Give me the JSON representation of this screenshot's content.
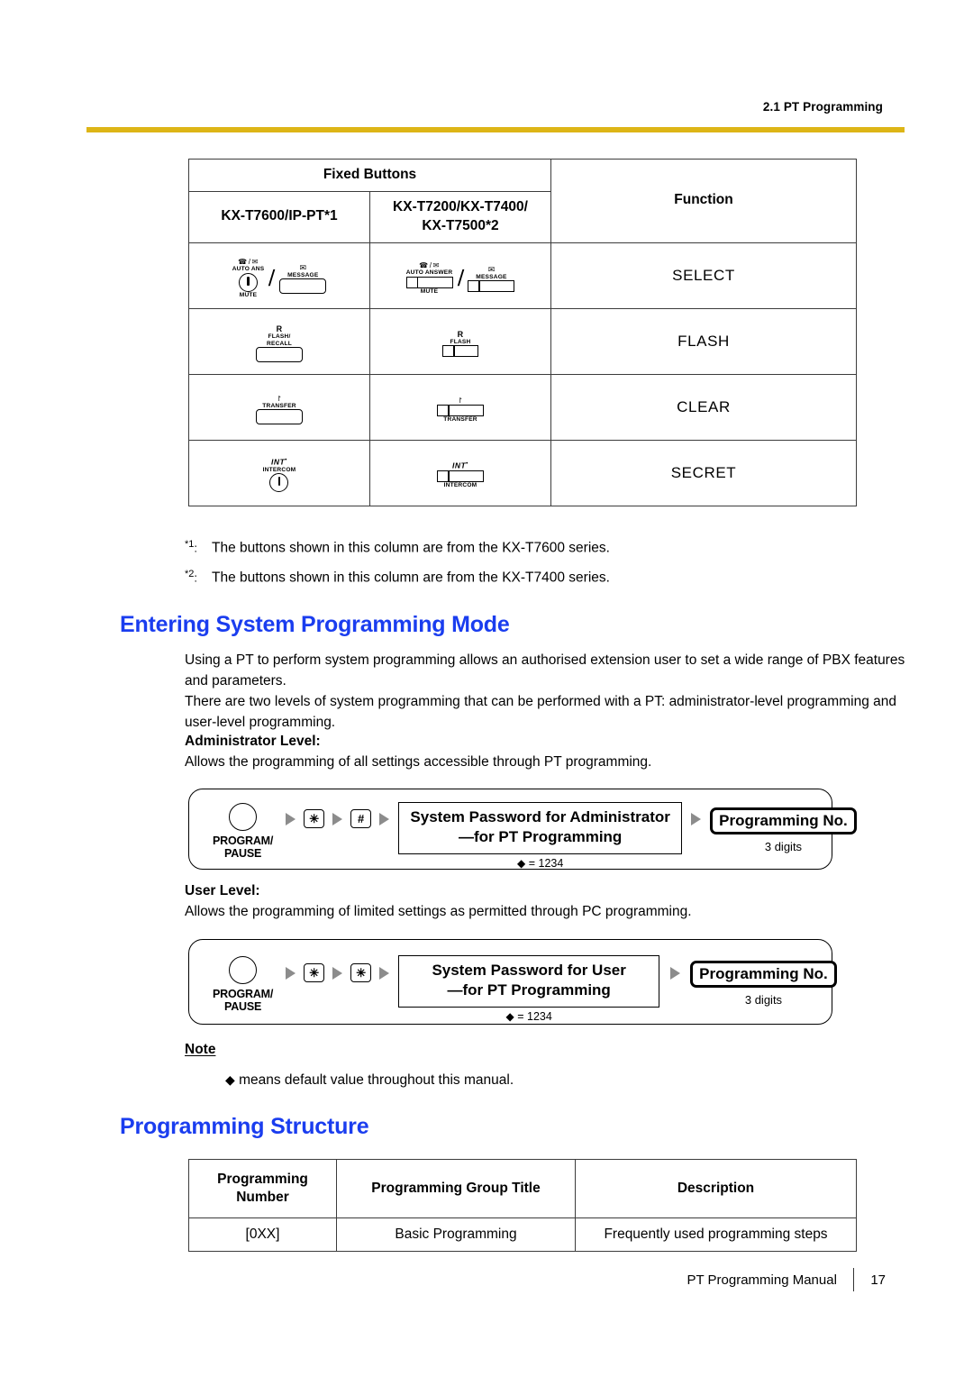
{
  "running_head": "2.1 PT Programming",
  "rule_color": "#ddb516",
  "heading_color": "#1a3def",
  "button_table": {
    "header": {
      "fixed_buttons": "Fixed Buttons",
      "col_7600": "KX-T7600/IP-PT*1",
      "col_7200_a": "KX-T7200/KX-T7400/",
      "col_7200_b": "KX-T7500*2",
      "function": "Function"
    },
    "rows": [
      {
        "function": "SELECT",
        "t7600": {
          "keys": [
            {
              "style": "round",
              "symbol": "auto-ans-mute-symbol",
              "cap_top": "AUTO ANS",
              "cap_bottom": "MUTE"
            },
            {
              "style": "rounded-rect",
              "symbol": "envelope-icon",
              "cap_top": "MESSAGE",
              "cap_bottom": ""
            }
          ]
        },
        "t7200": {
          "keys": [
            {
              "style": "flat",
              "symbol": "auto-ans-mute-symbol",
              "cap_top": "AUTO ANSWER",
              "cap_bottom": "MUTE"
            },
            {
              "style": "flat",
              "symbol": "envelope-icon",
              "cap_top": "MESSAGE",
              "cap_bottom": ""
            }
          ]
        }
      },
      {
        "function": "FLASH",
        "t7600": {
          "keys": [
            {
              "style": "rounded-rect",
              "symbol": "R",
              "cap_top": "FLASH/\nRECALL",
              "cap_bottom": ""
            }
          ]
        },
        "t7200": {
          "keys": [
            {
              "style": "flat-narrow",
              "symbol": "R",
              "cap_top": "FLASH",
              "cap_bottom": ""
            }
          ]
        }
      },
      {
        "function": "CLEAR",
        "t7600": {
          "keys": [
            {
              "style": "rounded-rect",
              "symbol": "transfer-arrow-icon",
              "cap_top": "TRANSFER",
              "cap_bottom": ""
            }
          ]
        },
        "t7200": {
          "keys": [
            {
              "style": "flat",
              "symbol": "transfer-arrow-icon",
              "cap_top": "",
              "cap_bottom": "TRANSFER"
            }
          ]
        }
      },
      {
        "function": "SECRET",
        "t7600": {
          "keys": [
            {
              "style": "round",
              "symbol": "INT",
              "cap_top": "INTERCOM",
              "cap_bottom": ""
            }
          ]
        },
        "t7200": {
          "keys": [
            {
              "style": "flat",
              "symbol": "INT",
              "cap_top": "",
              "cap_bottom": "INTERCOM"
            }
          ]
        }
      }
    ]
  },
  "footnotes": [
    {
      "mark": "*1",
      "text": "The buttons shown in this column are from the KX-T7600 series."
    },
    {
      "mark": "*2",
      "text": "The buttons shown in this column are from the KX-T7400 series."
    }
  ],
  "section_entering": {
    "title": "Entering System Programming Mode",
    "para1": "Using a PT to perform system programming allows an authorised extension user to set a wide range of PBX features and parameters.",
    "para2": "There are two levels of system programming that can be performed with a PT: administrator-level programming and user-level programming.",
    "admin_label": "Administrator Level:",
    "admin_desc": "Allows the programming of all settings accessible through PT programming.",
    "user_label": "User Level:",
    "user_desc": "Allows the programming of limited settings as permitted through PC programming."
  },
  "flow_admin": {
    "program_key_line1": "PROGRAM/",
    "program_key_line2": "PAUSE",
    "key1": "✳",
    "key2": "#",
    "password_line1": "System Password for Administrator",
    "password_line2": "—for PT Programming",
    "default_value": "= 1234",
    "diamond": "◆",
    "prog_no": "Programming No.",
    "prog_no_sub": "3 digits"
  },
  "flow_user": {
    "program_key_line1": "PROGRAM/",
    "program_key_line2": "PAUSE",
    "key1": "✳",
    "key2": "✳",
    "password_line1": "System Password for User",
    "password_line2": "—for PT Programming",
    "default_value": "= 1234",
    "diamond": "◆",
    "prog_no": "Programming No.",
    "prog_no_sub": "3 digits"
  },
  "note": {
    "heading": "Note",
    "diamond": "◆",
    "text": "means default value throughout this manual."
  },
  "section_structure": {
    "title": "Programming Structure",
    "headers": {
      "number_l1": "Programming",
      "number_l2": "Number",
      "group_title": "Programming Group Title",
      "description": "Description"
    },
    "rows": [
      {
        "number": "[0XX]",
        "group_title": "Basic Programming",
        "description": "Frequently used programming steps"
      }
    ]
  },
  "footer": {
    "manual": "PT Programming Manual",
    "page": "17"
  }
}
